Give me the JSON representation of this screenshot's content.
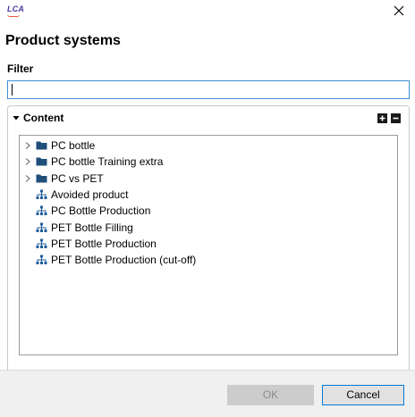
{
  "window": {
    "logo_text": "LCA",
    "close_icon": "close-icon"
  },
  "dialog": {
    "title": "Product systems",
    "filter_label": "Filter",
    "filter_value": "",
    "filter_placeholder": ""
  },
  "section": {
    "title": "Content",
    "expand_all_icon": "expand-all-icon",
    "collapse_all_icon": "collapse-all-icon"
  },
  "tree": {
    "items": [
      {
        "label": "PC bottle",
        "type": "folder",
        "expandable": true,
        "icon": "folder-icon"
      },
      {
        "label": "PC bottle Training extra",
        "type": "folder",
        "expandable": true,
        "icon": "folder-icon"
      },
      {
        "label": "PC vs PET",
        "type": "folder",
        "expandable": true,
        "icon": "folder-icon"
      },
      {
        "label": "Avoided product",
        "type": "product-system",
        "expandable": false,
        "icon": "product-system-icon"
      },
      {
        "label": "PC Bottle Production",
        "type": "product-system",
        "expandable": false,
        "icon": "product-system-icon"
      },
      {
        "label": "PET Bottle Filling",
        "type": "product-system",
        "expandable": false,
        "icon": "product-system-icon"
      },
      {
        "label": "PET Bottle Production",
        "type": "product-system",
        "expandable": false,
        "icon": "product-system-icon"
      },
      {
        "label": "PET Bottle Production (cut-off)",
        "type": "product-system",
        "expandable": false,
        "icon": "product-system-icon"
      }
    ]
  },
  "buttons": {
    "ok_label": "OK",
    "ok_enabled": false,
    "cancel_label": "Cancel"
  },
  "colors": {
    "folder": "#1f4e79",
    "product_system": "#1f5c99",
    "focus_border": "#3d8fd6",
    "cancel_border": "#0078d7"
  }
}
